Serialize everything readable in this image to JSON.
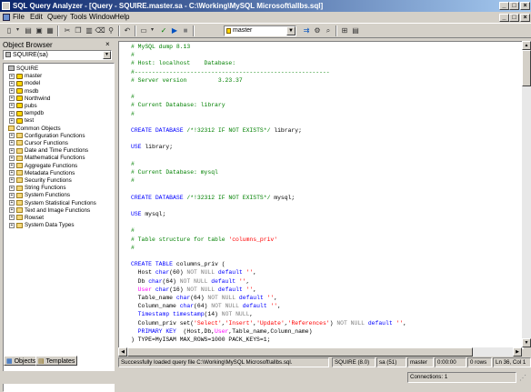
{
  "window": {
    "title": "SQL Query Analyzer - [Query - SQUIRE.master.sa - C:\\Working\\MySQL Microsoft\\allbs.sql]"
  },
  "menu": [
    "File",
    "Edit",
    "Query",
    "Tools",
    "Window",
    "Help"
  ],
  "toolbar": {
    "database": "master"
  },
  "object_browser": {
    "title": "Object Browser",
    "close": "×",
    "server_combo": "SQUIRE(sa)",
    "tree": [
      {
        "label": "SQUIRE",
        "level": 0,
        "icon": "server-icon",
        "expander": ""
      },
      {
        "label": "master",
        "level": 1,
        "icon": "database-icon",
        "expander": "+"
      },
      {
        "label": "model",
        "level": 1,
        "icon": "database-icon",
        "expander": "+"
      },
      {
        "label": "msdb",
        "level": 1,
        "icon": "database-icon",
        "expander": "+"
      },
      {
        "label": "Northwind",
        "level": 1,
        "icon": "database-icon",
        "expander": "+"
      },
      {
        "label": "pubs",
        "level": 1,
        "icon": "database-icon",
        "expander": "+"
      },
      {
        "label": "tempdb",
        "level": 1,
        "icon": "database-icon",
        "expander": "+"
      },
      {
        "label": "test",
        "level": 1,
        "icon": "database-icon",
        "expander": "+"
      },
      {
        "label": "Common Objects",
        "level": 0,
        "icon": "folder-icon",
        "expander": ""
      },
      {
        "label": "Configuration Functions",
        "level": 1,
        "icon": "folder-icon",
        "expander": "+"
      },
      {
        "label": "Cursor Functions",
        "level": 1,
        "icon": "folder-icon",
        "expander": "+"
      },
      {
        "label": "Date and Time Functions",
        "level": 1,
        "icon": "folder-icon",
        "expander": "+"
      },
      {
        "label": "Mathematical Functions",
        "level": 1,
        "icon": "folder-icon",
        "expander": "+"
      },
      {
        "label": "Aggregate Functions",
        "level": 1,
        "icon": "folder-icon",
        "expander": "+"
      },
      {
        "label": "Metadata Functions",
        "level": 1,
        "icon": "folder-icon",
        "expander": "+"
      },
      {
        "label": "Security Functions",
        "level": 1,
        "icon": "folder-icon",
        "expander": "+"
      },
      {
        "label": "String Functions",
        "level": 1,
        "icon": "folder-icon",
        "expander": "+"
      },
      {
        "label": "System Functions",
        "level": 1,
        "icon": "folder-icon",
        "expander": "+"
      },
      {
        "label": "System Statistical Functions",
        "level": 1,
        "icon": "folder-icon",
        "expander": "+"
      },
      {
        "label": "Text and Image Functions",
        "level": 1,
        "icon": "folder-icon",
        "expander": "+"
      },
      {
        "label": "Rowset",
        "level": 1,
        "icon": "folder-icon",
        "expander": "+"
      },
      {
        "label": "System Data Types",
        "level": 1,
        "icon": "folder-icon",
        "expander": "+"
      }
    ],
    "tabs": [
      "Objects",
      "Templates"
    ]
  },
  "editor": {
    "lines": [
      [
        [
          "cm",
          "# MySQL dump 8.13"
        ]
      ],
      [
        [
          "cm",
          "#"
        ]
      ],
      [
        [
          "cm",
          "# Host: localhost    Database:"
        ]
      ],
      [
        [
          "cm",
          "#--------------------------------------------------------"
        ]
      ],
      [
        [
          "cm",
          "# Server version         3.23.37"
        ]
      ],
      [
        [
          "",
          ""
        ]
      ],
      [
        [
          "cm",
          "#"
        ]
      ],
      [
        [
          "cm",
          "# Current Database: library"
        ]
      ],
      [
        [
          "cm",
          "#"
        ]
      ],
      [
        [
          "",
          ""
        ]
      ],
      [
        [
          "kw",
          "CREATE DATABASE "
        ],
        [
          "cm",
          "/*!32312 IF NOT EXISTS*/"
        ],
        [
          "",
          " library;"
        ]
      ],
      [
        [
          "",
          ""
        ]
      ],
      [
        [
          "kw",
          "USE "
        ],
        [
          "",
          "library;"
        ]
      ],
      [
        [
          "",
          ""
        ]
      ],
      [
        [
          "cm",
          "#"
        ]
      ],
      [
        [
          "cm",
          "# Current Database: mysql"
        ]
      ],
      [
        [
          "cm",
          "#"
        ]
      ],
      [
        [
          "",
          ""
        ]
      ],
      [
        [
          "kw",
          "CREATE DATABASE "
        ],
        [
          "cm",
          "/*!32312 IF NOT EXISTS*/"
        ],
        [
          "",
          " mysql;"
        ]
      ],
      [
        [
          "",
          ""
        ]
      ],
      [
        [
          "kw",
          "USE "
        ],
        [
          "",
          "mysql;"
        ]
      ],
      [
        [
          "",
          ""
        ]
      ],
      [
        [
          "cm",
          "#"
        ]
      ],
      [
        [
          "cm",
          "# Table structure for table "
        ],
        [
          "str",
          "'columns_priv'"
        ]
      ],
      [
        [
          "cm",
          "#"
        ]
      ],
      [
        [
          "",
          ""
        ]
      ],
      [
        [
          "kw",
          "CREATE TABLE "
        ],
        [
          "",
          "columns_priv ("
        ]
      ],
      [
        [
          "",
          "  Host "
        ],
        [
          "kw",
          "char"
        ],
        [
          "",
          "(60) "
        ],
        [
          "gy",
          "NOT NULL "
        ],
        [
          "kw",
          "default "
        ],
        [
          "str",
          "''"
        ],
        [
          "",
          ","
        ]
      ],
      [
        [
          "",
          "  Db "
        ],
        [
          "kw",
          "char"
        ],
        [
          "",
          "(64) "
        ],
        [
          "gy",
          "NOT NULL "
        ],
        [
          "kw",
          "default "
        ],
        [
          "str",
          "''"
        ],
        [
          "",
          ","
        ]
      ],
      [
        [
          "",
          "  "
        ],
        [
          "fn",
          "User "
        ],
        [
          "kw",
          "char"
        ],
        [
          "",
          "(16) "
        ],
        [
          "gy",
          "NOT NULL "
        ],
        [
          "kw",
          "default "
        ],
        [
          "str",
          "''"
        ],
        [
          "",
          ","
        ]
      ],
      [
        [
          "",
          "  Table_name "
        ],
        [
          "kw",
          "char"
        ],
        [
          "",
          "(64) "
        ],
        [
          "gy",
          "NOT NULL "
        ],
        [
          "kw",
          "default "
        ],
        [
          "str",
          "''"
        ],
        [
          "",
          ","
        ]
      ],
      [
        [
          "",
          "  Column_name "
        ],
        [
          "kw",
          "char"
        ],
        [
          "",
          "(64) "
        ],
        [
          "gy",
          "NOT NULL "
        ],
        [
          "kw",
          "default "
        ],
        [
          "str",
          "''"
        ],
        [
          "",
          ","
        ]
      ],
      [
        [
          "",
          "  "
        ],
        [
          "kw",
          "Timestamp timestamp"
        ],
        [
          "",
          "(14) "
        ],
        [
          "gy",
          "NOT NULL"
        ],
        [
          "",
          ","
        ]
      ],
      [
        [
          "",
          "  Column_priv set("
        ],
        [
          "str",
          "'Select'"
        ],
        [
          "",
          ","
        ],
        [
          "str",
          "'Insert'"
        ],
        [
          "",
          ","
        ],
        [
          "str",
          "'Update'"
        ],
        [
          "",
          ","
        ],
        [
          "str",
          "'References'"
        ],
        [
          "",
          ") "
        ],
        [
          "gy",
          "NOT NULL "
        ],
        [
          "kw",
          "default "
        ],
        [
          "str",
          "''"
        ],
        [
          "",
          ","
        ]
      ],
      [
        [
          "",
          "  "
        ],
        [
          "kw",
          "PRIMARY KEY  "
        ],
        [
          "",
          "(Host,Db,"
        ],
        [
          "fn",
          "User"
        ],
        [
          "",
          ",Table_name,Column_name)"
        ]
      ],
      [
        [
          "",
          ") TYPE=MyISAM MAX_ROWS=1000 PACK_KEYS=1;"
        ]
      ]
    ]
  },
  "status": {
    "message": "Successfully loaded query file C:\\Working\\MySQL Microsoft\\allbs.sql.",
    "server": "SQUIRE (8.0)",
    "user": "sa (51)",
    "database": "master",
    "elapsed": "0:00:00",
    "rows": "0 rows",
    "position": "Ln 36, Col 1",
    "connections": "Connections: 1"
  }
}
